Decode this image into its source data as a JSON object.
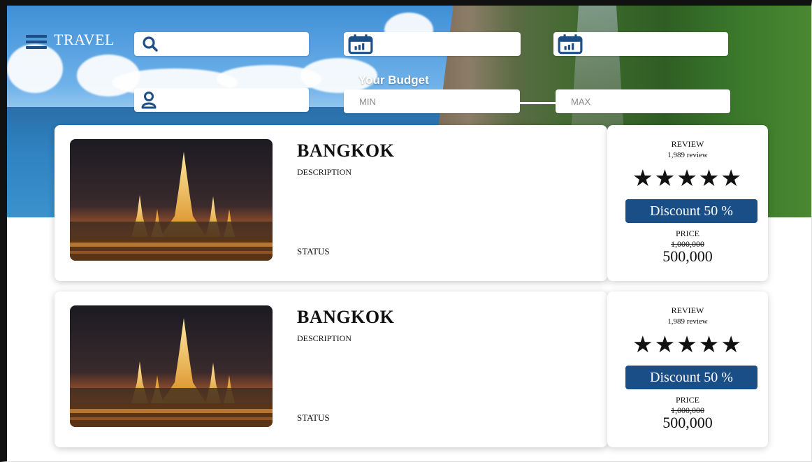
{
  "header": {
    "brand": "TRAVEL",
    "search_placeholder": "",
    "checkin_placeholder": "",
    "checkout_placeholder": "",
    "guests_placeholder": "",
    "budget_label": "Your Budget",
    "min_placeholder": "MIN",
    "max_placeholder": "MAX",
    "accent_color": "#1a4e87"
  },
  "listings": [
    {
      "city": "BANGKOK",
      "description_label": "DESCRIPTION",
      "status_label": "STATUS",
      "review_label": "REVIEW",
      "review_count": "1,989 review",
      "rating": 5,
      "stars": "★★★★★",
      "discount": "Discount 50 %",
      "price_label": "PRICE",
      "old_price": "1,000,000",
      "new_price": "500,000"
    },
    {
      "city": "BANGKOK",
      "description_label": "DESCRIPTION",
      "status_label": "STATUS",
      "review_label": "REVIEW",
      "review_count": "1,989 review",
      "rating": 5,
      "stars": "★★★★★",
      "discount": "Discount 50 %",
      "price_label": "PRICE",
      "old_price": "1,000,000",
      "new_price": "500,000"
    }
  ]
}
